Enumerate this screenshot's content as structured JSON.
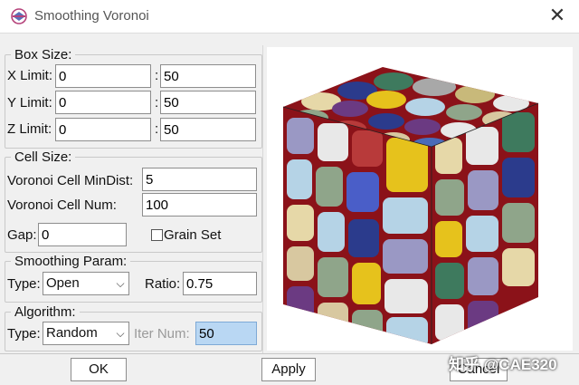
{
  "window": {
    "title": "Smoothing Voronoi",
    "close_glyph": "✕"
  },
  "box_size": {
    "legend": "Box Size:",
    "x": {
      "label": "X Limit:",
      "min": "0",
      "max": "50"
    },
    "y": {
      "label": "Y Limit:",
      "min": "0",
      "max": "50"
    },
    "z": {
      "label": "Z Limit:",
      "min": "0",
      "max": "50"
    },
    "colon": ":"
  },
  "cell_size": {
    "legend": "Cell Size:",
    "min_dist_label": "Voronoi Cell MinDist:",
    "min_dist_value": "5",
    "num_label": "Voronoi Cell Num:",
    "num_value": "100",
    "gap_label": "Gap:",
    "gap_value": "0",
    "grain_set_label": "Grain Set",
    "grain_set_checked": false
  },
  "smoothing": {
    "legend": "Smoothing Param:",
    "type_label": "Type:",
    "type_value": "Open",
    "ratio_label": "Ratio:",
    "ratio_value": "0.75"
  },
  "algorithm": {
    "legend": "Algorithm:",
    "type_label": "Type:",
    "type_value": "Random",
    "iter_label": "Iter Num:",
    "iter_value": "50"
  },
  "buttons": {
    "ok": "OK",
    "apply": "Apply",
    "cancel": "Cancel"
  },
  "watermark": "知乎 @CAE320",
  "colors": {
    "cell_border": "#8b1219",
    "accent_blue": "#b9d7f3"
  }
}
